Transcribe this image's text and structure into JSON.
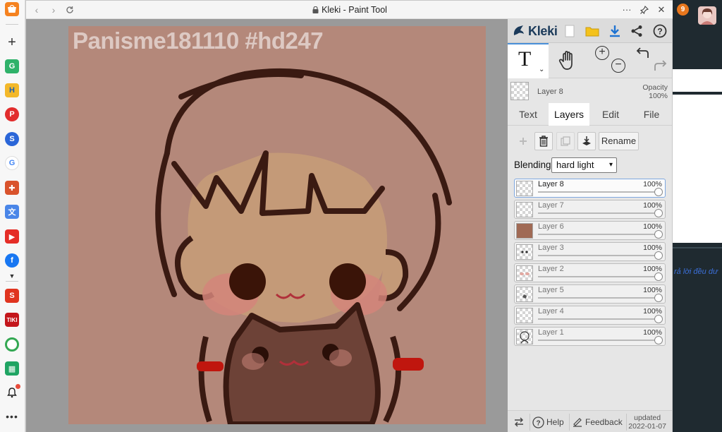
{
  "browser": {
    "sidebar_icons": [
      "shop-icon",
      "add-icon",
      "grammarly-icon",
      "h-app-icon",
      "pinterest-icon",
      "shopee-icon",
      "google-icon",
      "puzzle-icon",
      "translate-icon",
      "youtube-icon",
      "facebook-icon",
      "chevron-down-icon",
      "tet-app-icon",
      "tiki-icon",
      "chrome-icon",
      "sheets-icon",
      "bell-icon",
      "more-icon"
    ]
  },
  "popup": {
    "title": "Kleki - Paint Tool"
  },
  "canvas": {
    "watermark": "Panisme181110 #hd247",
    "background_color": "#b4887a"
  },
  "panel": {
    "logo_text": "Kleki",
    "current_layer": {
      "name": "Layer 8",
      "opacity_label": "Opacity",
      "opacity_value": "100%"
    },
    "tabs": [
      {
        "label": "Text"
      },
      {
        "label": "Layers"
      },
      {
        "label": "Edit"
      },
      {
        "label": "File"
      }
    ],
    "rename_label": "Rename",
    "blending_label": "Blending",
    "blending_value": "hard light",
    "layers": [
      {
        "name": "Layer 8",
        "opacity": "100%"
      },
      {
        "name": "Layer 7",
        "opacity": "100%"
      },
      {
        "name": "Layer 6",
        "opacity": "100%"
      },
      {
        "name": "Layer 3",
        "opacity": "100%"
      },
      {
        "name": "Layer 2",
        "opacity": "100%"
      },
      {
        "name": "Layer 5",
        "opacity": "100%"
      },
      {
        "name": "Layer 4",
        "opacity": "100%"
      },
      {
        "name": "Layer 1",
        "opacity": "100%"
      }
    ],
    "footer": {
      "help": "Help",
      "feedback": "Feedback",
      "updated_label": "updated",
      "updated_date": "2022-01-07"
    }
  },
  "background_page": {
    "notification_count": "9",
    "link_fragment": "rả lời đều dư"
  }
}
